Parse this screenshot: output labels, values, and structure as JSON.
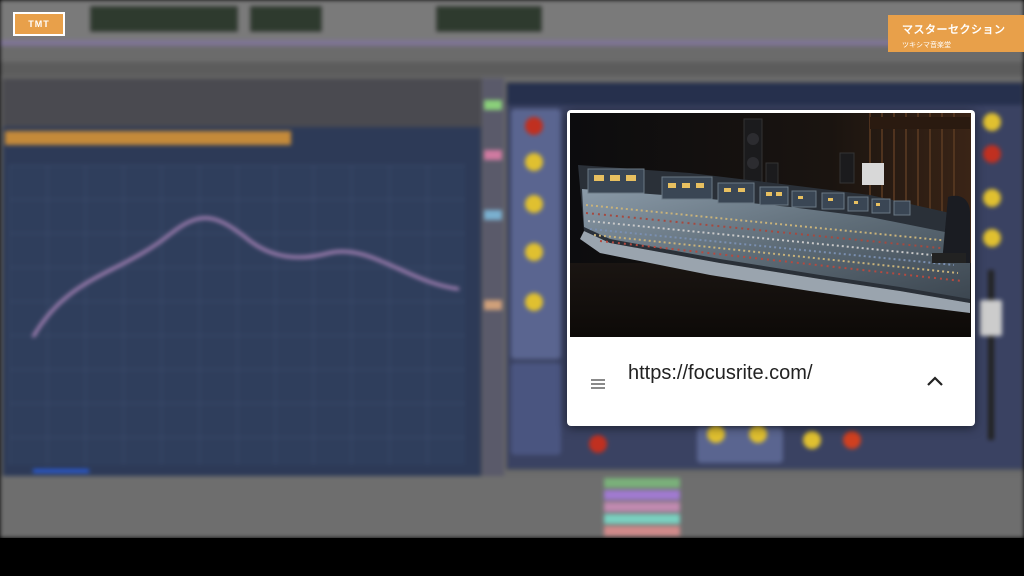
{
  "logo": {
    "text": "TMT"
  },
  "title_badge": {
    "title": "マスターセクション",
    "subtitle": "ツキシマ音楽堂"
  },
  "link_card": {
    "url": "https://focusrite.com/",
    "menu_icon": "hamburger-menu-icon",
    "collapse_icon": "chevron-up-icon",
    "image": "mixing-console-photo"
  },
  "colors": {
    "accent": "#e8a04a",
    "eq_curve": "#b48ac0",
    "card_bg": "#ffffff"
  }
}
